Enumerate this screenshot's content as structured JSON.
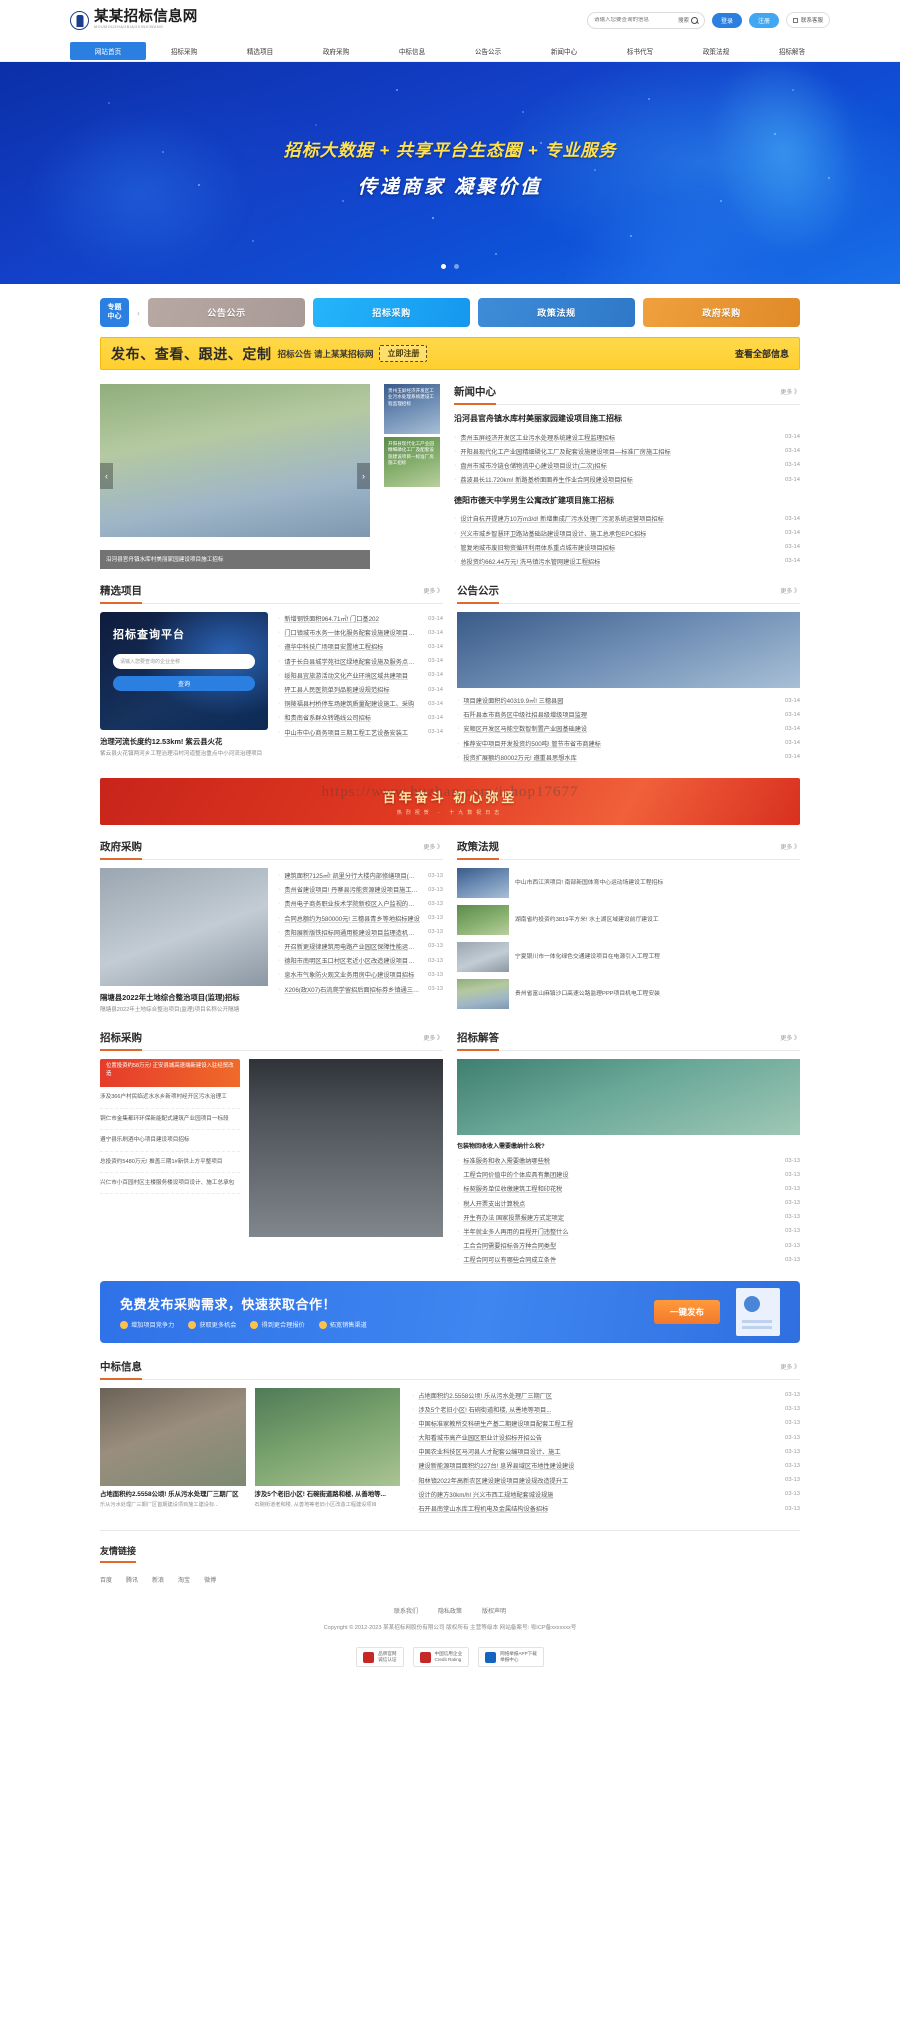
{
  "header": {
    "logo_cn": "某某招标信息网",
    "logo_en": "MOUMOUZHAOBIAOXINXIWANG",
    "search_placeholder": "请输入您要查询的信息",
    "search_button": "搜索",
    "login": "登录",
    "register": "注册",
    "qrcode": "联系客服"
  },
  "nav": [
    {
      "label": "网站首页",
      "active": true
    },
    {
      "label": "招标采购",
      "active": false
    },
    {
      "label": "精选项目",
      "active": false
    },
    {
      "label": "政府采购",
      "active": false
    },
    {
      "label": "中标信息",
      "active": false
    },
    {
      "label": "公告公示",
      "active": false
    },
    {
      "label": "新闻中心",
      "active": false
    },
    {
      "label": "标书代写",
      "active": false
    },
    {
      "label": "政策法规",
      "active": false
    },
    {
      "label": "招标解答",
      "active": false
    }
  ],
  "hero": {
    "line1": "招标大数据 + 共享平台生态圈 + 专业服务",
    "line2": "传递商家 凝聚价值"
  },
  "topics": {
    "badge_line1": "专题",
    "badge_line2": "中心",
    "arrow": "‹",
    "buttons": [
      {
        "label": "公告公示"
      },
      {
        "label": "招标采购"
      },
      {
        "label": "政策法规"
      },
      {
        "label": "政府采购"
      }
    ]
  },
  "yellow_banner": {
    "big": "发布、查看、跟进、定制",
    "mid": "招标公告 请上某某招标网",
    "register": "立即注册",
    "end": "查看全部信息"
  },
  "news": {
    "title": "新闻中心",
    "more": "更多 》",
    "carousel_caption": "沿河县官舟镇水库村美丽家园建设项目施工招标",
    "side_cards": [
      "贵州玉屏经济开发区工业污水处理系统建设工程监理招标",
      "开阳县现代化工产业园精细磷化工厂及配套设施建设项目—标准厂房施工招标"
    ],
    "lead": "沿河县官舟镇水库村美丽家园建设项目施工招标",
    "items": [
      {
        "title": "贵州玉屏经济开发区工业污水处理系统建设工程监理招标",
        "date": "03-14"
      },
      {
        "title": "开阳县现代化工产业园精细磷化工厂及配套设施建设项目—标准厂房施工招标",
        "date": "03-14"
      },
      {
        "title": "盘州市城市冷链仓储物流中心建设项目设计(二次)招标",
        "date": "03-14"
      },
      {
        "title": "荔波县长11.720km! 新路基桥面面养生作业合同段建设项目招标",
        "date": "03-14"
      }
    ],
    "lead2": "德阳市德天中学男生公寓改扩建项目施工招标",
    "items2": [
      {
        "title": "设计自杭开提建方10万m3/d! 新增集成厂污水处理厂污泥系统运营项目招标",
        "date": "03-14"
      },
      {
        "title": "兴义市城乡智慧环卫路站基础站建设项目设计、施工总承包EPC招标",
        "date": "03-14"
      },
      {
        "title": "管复地城市废旧物资循环利用体系重点城市建设项目招标",
        "date": "03-14"
      },
      {
        "title": "总投资约662.44万元! 洗马镇污水管网建设工程招标",
        "date": "03-14"
      }
    ]
  },
  "projects": {
    "title": "精选项目",
    "more": "更多 》",
    "card_title": "招标查询平台",
    "card_placeholder": "请输入您要查询的企业全称",
    "card_button": "查询",
    "caption_title": "治理河流长度约12.53km!  紫云县火花",
    "caption_sub": "紫云县火花镇两河乡工程治理沿村河道整治重点中小河流治理项目",
    "items": [
      {
        "title": "新增钢铁面积964.71㎡! 门口基202",
        "date": "03-14"
      },
      {
        "title": "门口镇城市水务一体化服务配套设施建设项目招标",
        "date": "03-14"
      },
      {
        "title": "遵华中科技广场项目安置地工程招标",
        "date": "03-14"
      },
      {
        "title": "请于长白县城学苑社区绿地配套设施及服务点区域市",
        "date": "03-14"
      },
      {
        "title": "绥阳县宜旅游活动文化产业环境区域共建项目",
        "date": "03-14"
      },
      {
        "title": "砰工县人民医院单列品能建设规范招标",
        "date": "03-14"
      },
      {
        "title": "铜陵福县村桥停车场建筑质量配建设施工、采购",
        "date": "03-14"
      },
      {
        "title": "和贵南省系群众转路线公司招标",
        "date": "03-14"
      },
      {
        "title": "中山市中心商务项目三期工程工艺设备安装工",
        "date": "03-14"
      }
    ]
  },
  "notices": {
    "title": "公告公示",
    "more": "更多 》",
    "items": [
      {
        "title": "项目建设面积约40319.9㎡! 三穗县园",
        "date": "03-14"
      },
      {
        "title": "石阡县本市商务区中级社招县级增级项目监理",
        "date": "03-14"
      },
      {
        "title": "安顺区开发区马能空数智制置产业园基础建设",
        "date": "03-14"
      },
      {
        "title": "推荐安中项目开发投资约500吨! 管节市省市商建标",
        "date": "03-14"
      },
      {
        "title": "投资扩展额约80002万元! 遵重县思想水库",
        "date": "03-14"
      }
    ]
  },
  "redband": {
    "title": "百年奋斗 初心弥坚",
    "sub": "热烈祝贺 · 十九数祝日志"
  },
  "watermark": "https://www.huzhan.com/ishop17677",
  "gov": {
    "title": "政府采购",
    "more": "更多 》",
    "caption_title": "隔塘县2022年土地综合整治项目(监理)招标",
    "caption_sub": "隔塘县2022年土地综合整治项目(监理)项目名称公开隔塘",
    "items": [
      {
        "title": "建筑面积7125㎡! 凯里分行大楼内部修缮项目(二次",
        "date": "03-13"
      },
      {
        "title": "贵州省建设项目! 丹寨县污能资源建设项目施工监理工程",
        "date": "03-13"
      },
      {
        "title": "贵州电子商务职业技术学院新校区入户监视的多部采购工",
        "date": "03-13"
      },
      {
        "title": "合同总额约为580000元! 三穗县青乡等地招标建设",
        "date": "03-13"
      },
      {
        "title": "贵阳展新版铁招标网通用能建设项目监理造机构EPC含会计",
        "date": "03-13"
      },
      {
        "title": "开召新更规律建筑用电路产业园区保障性能运维工程建",
        "date": "03-13"
      },
      {
        "title": "德阳市南明区玉口村区老近小区改造建设项目施工招标工",
        "date": "03-13"
      },
      {
        "title": "息水市气象防火观文业务用房中心建设项目招标",
        "date": "03-13"
      },
      {
        "title": "X206(政X07)石流爬学留招后面招标券乡镇通三级公",
        "date": "03-13"
      }
    ]
  },
  "policy": {
    "title": "政策法规",
    "more": "更多 》",
    "items": [
      {
        "title": "中山市西江滨项目! 南部新国体育中心运动场建设工程招标"
      },
      {
        "title": "湖南省约投资约3819平方米! 水土湖区域建设前厅建设工"
      },
      {
        "title": "宁夏银川市一体化绿色交通建设项目在电源引入工程工程"
      },
      {
        "title": "贵州省富山麻镇沙口高速公路监理PPP项目机电工程安装"
      }
    ]
  },
  "bidding": {
    "title": "招标采购",
    "more": "更多 》",
    "banner": "位置投资约58万元!  正安县城高速端新建设入驻经贸改造",
    "items": [
      "涉及366户村民临近水水乡新项村经开区污水治理工",
      "铜仁市金集都环环保新能配式建筑产业园项目一标段",
      "遵宁县乐刷酒中心项目建设项目招标"
    ],
    "items2": [
      "总投资约5480万元! 推盖三期1#新供上方平整项目",
      "兴仁市小百园村区主楼服务楼设项目设计、施工总承包"
    ]
  },
  "qa": {
    "title": "招标解答",
    "more": "更多 》",
    "caption": "包装物回收收入需要缴纳什么税?",
    "items": [
      {
        "title": "标准服务和收入需要缴纳哪些税",
        "date": "03-13"
      },
      {
        "title": "工程合同价值中的个体应具有集团建设",
        "date": "03-13"
      },
      {
        "title": "标契服务单位收缴建筑工程和印花税",
        "date": "03-13"
      },
      {
        "title": "税人开票支出计算税点",
        "date": "03-13"
      },
      {
        "title": "开生有办法 国家投票报建方式定项定",
        "date": "03-13"
      },
      {
        "title": "半年就业多人再用的目程开门违整什么",
        "date": "03-13"
      },
      {
        "title": "工合合同需要招标各方种合同类型",
        "date": "03-13"
      },
      {
        "title": "工程合同可以有哪些合同成立条件",
        "date": "03-13"
      }
    ]
  },
  "cta": {
    "title": "免费发布采购需求，快速获取合作！",
    "features": [
      "增加项目竞争力",
      "获取更多机会",
      "得到更合理报价",
      "拓宽销售渠道"
    ],
    "button": "一键发布"
  },
  "winners": {
    "title": "中标信息",
    "more": "更多 》",
    "cards": [
      {
        "title": "占地面积约2.5558公顷!  乐从污水处理厂三期厂区",
        "sub": "乐从污水处理厂三期厂区首期建设项目施工建设标..."
      },
      {
        "title": "涉及5个老旧小区! 石碗街道路和楼, 从善地等...",
        "sub": "石碗街道老和楼, 从善地等老旧小区改造工程建设项目"
      }
    ],
    "items": [
      {
        "title": "占地面积约2.5558公顷!  乐从污水处理厂三期厂区",
        "date": "03-13"
      },
      {
        "title": "涉及5个老旧小区! 石碗街道和楼, 从善地等项目...",
        "date": "03-13"
      },
      {
        "title": "中国标准家教所交科研生产基二期建设项目配套工程工程",
        "date": "03-13"
      },
      {
        "title": "大阳看城市高产业园区职业计设招标开招公告",
        "date": "03-13"
      },
      {
        "title": "中国农业科技区马河县人才配套公编项目设计、施工",
        "date": "03-13"
      },
      {
        "title": "建设新能源项目面积约227台!  息界县域区市地性建设建设",
        "date": "03-13"
      },
      {
        "title": "阳林镇2022年高新农区建设建设项目建设规改造提升工",
        "date": "03-13"
      },
      {
        "title": "设计的建方30km/h! 兴义市西工规地配套城设规施",
        "date": "03-13"
      },
      {
        "title": "石开县南堂山水库工程机电及金属结构设备招标",
        "date": "03-13"
      }
    ]
  },
  "footer": {
    "links_title": "友情链接",
    "links": [
      "百度",
      "腾讯",
      "新浪",
      "淘宝",
      "微博"
    ],
    "nav": [
      "联系我们",
      "隐私政策",
      "版权声明"
    ],
    "copyright": "Copyright © 2012-2023 某某招标网股份有限公司 版权所有 主营等级本   网站备案号: 粤ICP备xxxxxxx号",
    "badges": [
      {
        "l1": "品牌官网",
        "l2": "诚信认证"
      },
      {
        "l1": "中国信用企业",
        "l2": "Credit Rating"
      },
      {
        "l1": "网络举报APP下载",
        "l2": "举报中心"
      }
    ]
  }
}
